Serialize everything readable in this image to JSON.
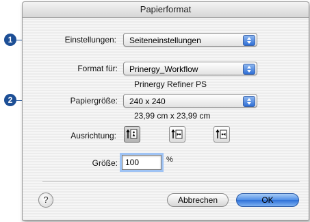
{
  "window": {
    "title": "Papierformat"
  },
  "callouts": [
    "1",
    "2"
  ],
  "settings": {
    "label": "Einstellungen:",
    "value": "Seiteneinstellungen"
  },
  "format_for": {
    "label": "Format für:",
    "value": "Prinergy_Workflow",
    "sub": "Prinergy Refiner PS"
  },
  "paper_size": {
    "label": "Papiergröße:",
    "value": "240 x 240",
    "dimensions": "23,99 cm x 23,99 cm"
  },
  "orientation": {
    "label": "Ausrichtung:",
    "options": [
      "portrait-icon",
      "landscape-left-icon",
      "landscape-right-icon"
    ],
    "selected": 0
  },
  "scale": {
    "label": "Größe:",
    "value": "100",
    "unit": "%"
  },
  "buttons": {
    "help": "?",
    "cancel": "Abbrechen",
    "ok": "OK"
  },
  "colors": {
    "accent": "#2f71d8",
    "callout": "#1d4f96"
  }
}
